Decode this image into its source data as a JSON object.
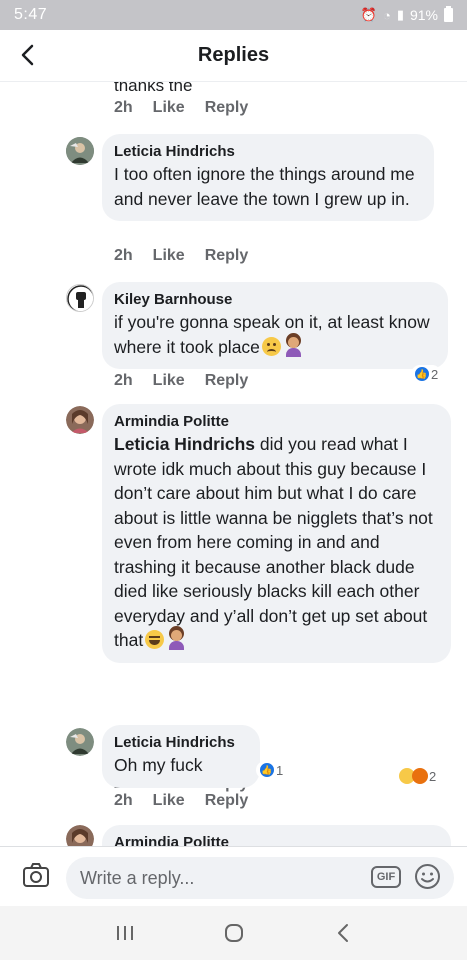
{
  "status_bar": {
    "time": "5:47",
    "battery": "91%"
  },
  "header": {
    "title": "Replies"
  },
  "partial_comment": {
    "text": "thanks the"
  },
  "actions": {
    "like": "Like",
    "reply": "Reply"
  },
  "comments": [
    {
      "time": "2h"
    },
    {
      "author": "Leticia Hindrichs",
      "text": "I too often ignore the things around me and never leave the town I grew up in.",
      "time": "2h"
    },
    {
      "author": "Kiley Barnhouse",
      "text": "if you're gonna speak on it, at least know where it took place",
      "time": "2h",
      "reaction_count": "2"
    },
    {
      "author": "Armindia Politte",
      "mention": "Leticia Hindrichs",
      "text": " did you read what I wrote idk much about this guy because I don’t care about him but what I do care about is little wanna be nigglets that’s not even from here coming in and and trashing it because another black dude died like seriously blacks kill each other everyday and y’all don’t get up set about that",
      "time": "2h",
      "reaction_count": "2"
    },
    {
      "author": "Leticia Hindrichs",
      "text": "Oh my fuck",
      "time": "2h",
      "reaction_count": "1"
    },
    {
      "author": "Armindia Politte"
    }
  ],
  "composer": {
    "placeholder": "Write a reply...",
    "gif_label": "GIF"
  },
  "colors": {
    "bubble": "#f0f2f5",
    "like_blue": "#1b74e4",
    "muted": "#65676b"
  }
}
